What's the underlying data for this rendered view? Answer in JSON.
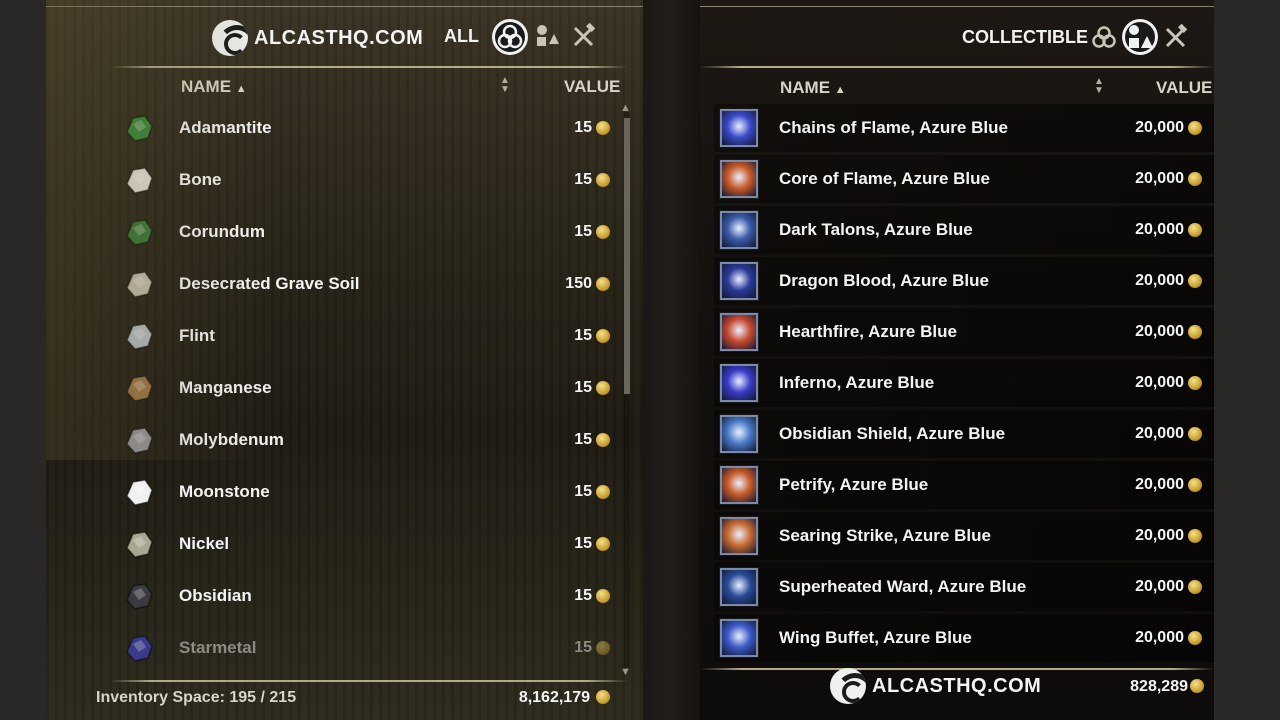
{
  "left": {
    "logo_text": "ALCASTHQ.COM",
    "filter_label": "ALL",
    "filter_icons": [
      "all-filter-icon",
      "furnishing-filter-icon",
      "crafting-filter-icon"
    ],
    "col_name": "NAME",
    "col_value": "VALUE",
    "items": [
      {
        "name": "Adamantite",
        "value": "15",
        "icon": "adamantite-icon",
        "color": "#3a8a3a"
      },
      {
        "name": "Bone",
        "value": "15",
        "icon": "bone-icon",
        "color": "#e8e4dc"
      },
      {
        "name": "Corundum",
        "value": "15",
        "icon": "corundum-icon",
        "color": "#3a7a3a"
      },
      {
        "name": "Desecrated Grave Soil",
        "value": "150",
        "icon": "grave-soil-icon",
        "color": "#c8c0b0"
      },
      {
        "name": "Flint",
        "value": "15",
        "icon": "flint-icon",
        "color": "#b8c0c8"
      },
      {
        "name": "Manganese",
        "value": "15",
        "icon": "manganese-icon",
        "color": "#a07848"
      },
      {
        "name": "Molybdenum",
        "value": "15",
        "icon": "molybdenum-icon",
        "color": "#9a9aa0"
      },
      {
        "name": "Moonstone",
        "value": "15",
        "icon": "moonstone-icon",
        "color": "#f0f0f0"
      },
      {
        "name": "Nickel",
        "value": "15",
        "icon": "nickel-icon",
        "color": "#a8a890"
      },
      {
        "name": "Obsidian",
        "value": "15",
        "icon": "obsidian-icon",
        "color": "#3a3a40"
      },
      {
        "name": "Starmetal",
        "value": "15",
        "icon": "starmetal-icon",
        "color": "#3a3a8a"
      }
    ],
    "inventory_label": "Inventory Space: 195 / 215",
    "gold": "8,162,179"
  },
  "right": {
    "filter_label": "COLLECTIBLE",
    "filter_icons": [
      "all-filter-icon",
      "furnishing-filter-icon",
      "crafting-filter-icon"
    ],
    "col_name": "NAME",
    "col_value": "VALUE",
    "items": [
      {
        "name": "Chains of Flame, Azure Blue",
        "value": "20,000",
        "icon": "chains-of-flame-icon",
        "color": "#3a4ac8"
      },
      {
        "name": "Core of Flame, Azure Blue",
        "value": "20,000",
        "icon": "core-of-flame-icon",
        "color": "#c85a28"
      },
      {
        "name": "Dark Talons, Azure Blue",
        "value": "20,000",
        "icon": "dark-talons-icon",
        "color": "#3a5aa8"
      },
      {
        "name": "Dragon Blood, Azure Blue",
        "value": "20,000",
        "icon": "dragon-blood-icon",
        "color": "#2a3a98"
      },
      {
        "name": "Hearthfire, Azure Blue",
        "value": "20,000",
        "icon": "hearthfire-icon",
        "color": "#c84a30"
      },
      {
        "name": "Inferno, Azure Blue",
        "value": "20,000",
        "icon": "inferno-icon",
        "color": "#3a3ac8"
      },
      {
        "name": "Obsidian Shield, Azure Blue",
        "value": "20,000",
        "icon": "obsidian-shield-icon",
        "color": "#4a7ac8"
      },
      {
        "name": "Petrify, Azure Blue",
        "value": "20,000",
        "icon": "petrify-icon",
        "color": "#c85a28"
      },
      {
        "name": "Searing Strike, Azure Blue",
        "value": "20,000",
        "icon": "searing-strike-icon",
        "color": "#c86a30"
      },
      {
        "name": "Superheated Ward, Azure Blue",
        "value": "20,000",
        "icon": "superheated-ward-icon",
        "color": "#2a4a98"
      },
      {
        "name": "Wing Buffet, Azure Blue",
        "value": "20,000",
        "icon": "wing-buffet-icon",
        "color": "#3a5ac8"
      }
    ],
    "logo_text": "ALCASTHQ.COM",
    "gold": "828,289"
  }
}
